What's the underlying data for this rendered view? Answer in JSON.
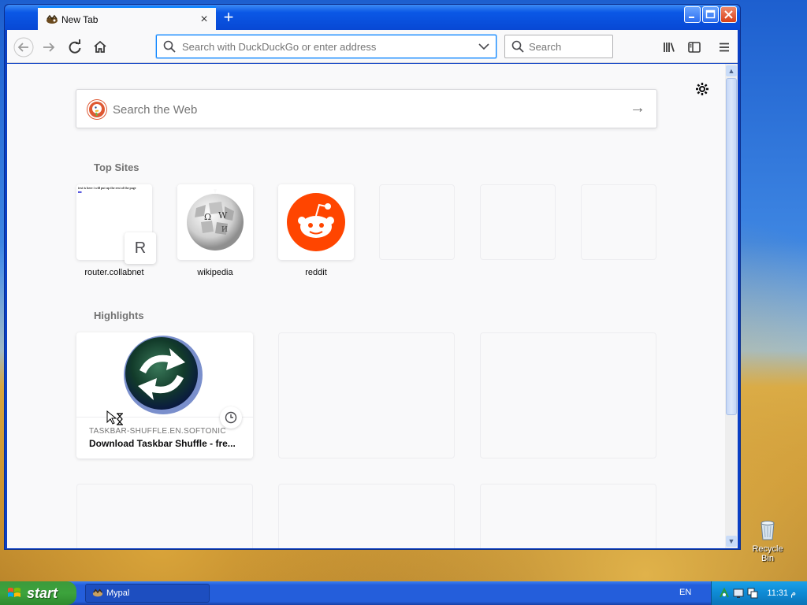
{
  "browser": {
    "tab": {
      "title": "New Tab",
      "close_label": "×"
    },
    "new_tab_label": "+",
    "window_controls": [
      "minimize",
      "maximize",
      "close"
    ],
    "urlbar": {
      "placeholder": "Search with DuckDuckGo or enter address",
      "value": ""
    },
    "searchbar": {
      "placeholder": "Search",
      "value": ""
    },
    "icons": {
      "back": "back-arrow-icon",
      "forward": "forward-arrow-icon",
      "reload": "reload-icon",
      "home": "home-icon",
      "library": "library-icon",
      "sidebar": "sidebar-icon",
      "menu": "hamburger-menu-icon"
    }
  },
  "newtab": {
    "web_search": {
      "placeholder": "Search the Web",
      "value": ""
    },
    "settings_icon": "gear-icon",
    "top_sites": {
      "title": "Top Sites",
      "items": [
        {
          "label": "router.collabnet",
          "tile": "R",
          "preview_text": "text is here i will put up the rest of the page"
        },
        {
          "label": "wikipedia"
        },
        {
          "label": "reddit"
        }
      ]
    },
    "highlights": {
      "title": "Highlights",
      "items": [
        {
          "source": "TASKBAR-SHUFFLE.EN.SOFTONIC",
          "title": "Download Taskbar Shuffle - fre..."
        }
      ]
    }
  },
  "desktop": {
    "recycle_bin_label": "Recycle Bin"
  },
  "taskbar": {
    "start_label": "start",
    "task_item_label": "Mypal",
    "language": "EN",
    "clock": "11:31 م"
  },
  "colors": {
    "accent": "#0a84ff",
    "reddit": "#ff4500",
    "ddg": "#de5833",
    "xp_blue": "#245edb",
    "xp_green": "#3ca33c"
  }
}
